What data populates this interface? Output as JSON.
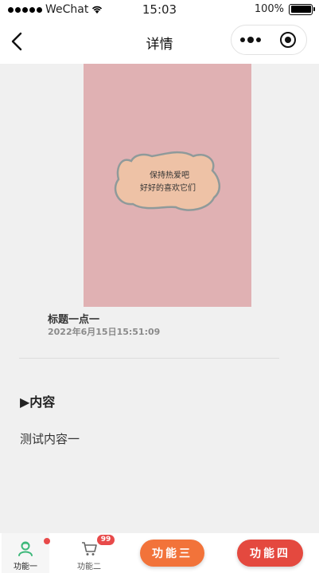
{
  "status_bar": {
    "carrier": "WeChat",
    "time": "15:03",
    "battery": "100%"
  },
  "nav": {
    "title": "详情"
  },
  "post": {
    "cover_text": [
      "保持热爱吧",
      "好好的喜欢它们"
    ],
    "title": "标题一点一",
    "time": "2022年6月15日15:51:09"
  },
  "section": {
    "heading": "▶内容",
    "body": "测试内容一"
  },
  "tabs": [
    {
      "label": "功能一",
      "icon": "person-icon",
      "active": true
    },
    {
      "label": "功能二",
      "icon": "cart-icon",
      "badge": "99"
    }
  ],
  "actions": [
    {
      "label": "功能三",
      "color": "#f2733a"
    },
    {
      "label": "功能四",
      "color": "#e4493f"
    }
  ],
  "colors": {
    "cover_bg": "#e0b1b3",
    "sticker_fill": "#eec2a6",
    "sticker_outline": "#8f9a9a",
    "active_tab_icon": "#3db87a",
    "badge_red": "#e84a4a"
  }
}
